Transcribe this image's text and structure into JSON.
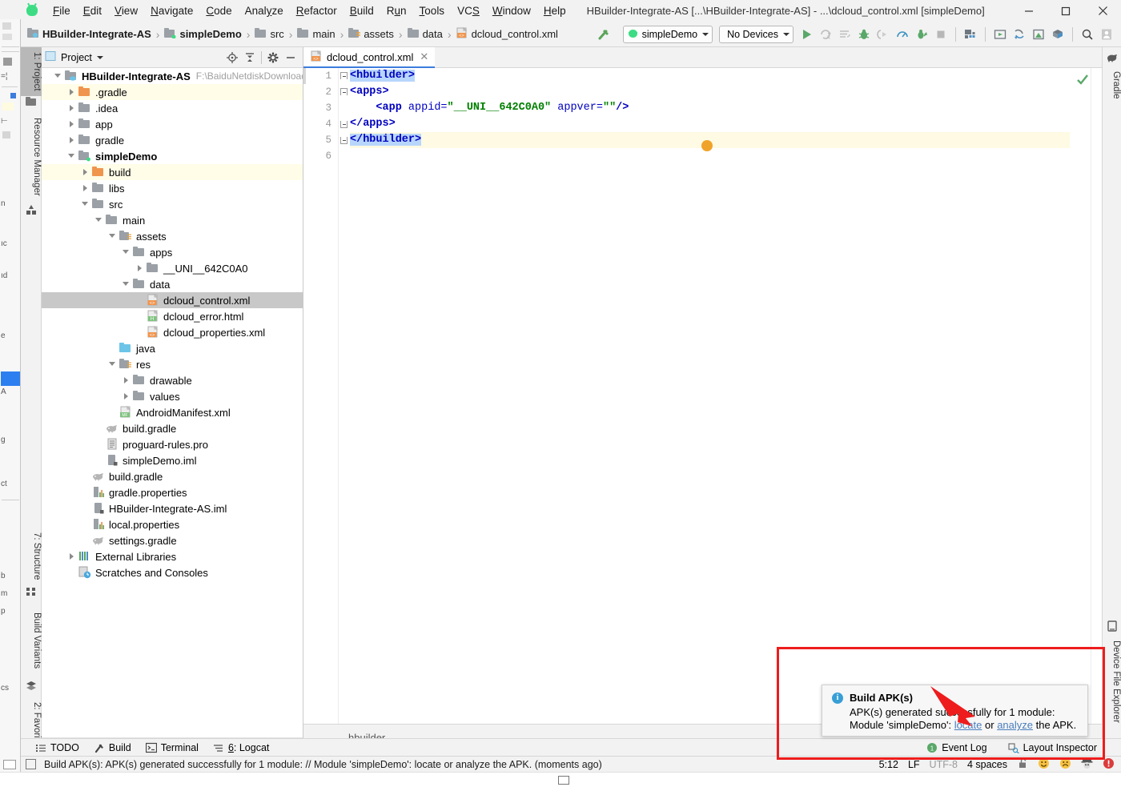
{
  "window": {
    "title": "HBuilder-Integrate-AS [...\\HBuilder-Integrate-AS] - ...\\dcloud_control.xml [simpleDemo]",
    "minimize": "minimize-icon",
    "maximize": "maximize-icon",
    "close": "close-icon"
  },
  "menu": {
    "items": [
      {
        "label": "File"
      },
      {
        "label": "Edit"
      },
      {
        "label": "View"
      },
      {
        "label": "Navigate"
      },
      {
        "label": "Code"
      },
      {
        "label": "Analyze"
      },
      {
        "label": "Refactor"
      },
      {
        "label": "Build"
      },
      {
        "label": "Run"
      },
      {
        "label": "Tools"
      },
      {
        "label": "VCS"
      },
      {
        "label": "Window"
      },
      {
        "label": "Help"
      }
    ]
  },
  "navbar": {
    "breadcrumbs": [
      {
        "label": "HBuilder-Integrate-AS",
        "icon": "module-icon",
        "bold": true
      },
      {
        "label": "simpleDemo",
        "icon": "module-icon",
        "bold": true
      },
      {
        "label": "src",
        "icon": "folder-icon",
        "bold": false
      },
      {
        "label": "main",
        "icon": "folder-icon",
        "bold": false
      },
      {
        "label": "assets",
        "icon": "source-folder-icon",
        "bold": false
      },
      {
        "label": "data",
        "icon": "folder-icon",
        "bold": false
      },
      {
        "label": "dcloud_control.xml",
        "icon": "xml-file-icon",
        "bold": false
      }
    ],
    "separator": "›",
    "run_config": "simpleDemo",
    "device_selector": "No Devices",
    "icons": [
      "hammer-build-icon",
      "run-icon",
      "apply-changes-icon",
      "apply-code-changes-icon",
      "debug-icon",
      "attach-debugger-icon",
      "profiler-icon",
      "run-with-coverage-icon",
      "stop-icon",
      "sdk-manager-icon",
      "avd-manager-icon",
      "sync-gradle-icon",
      "device-manager-icon",
      "project-structure-icon",
      "search-icon",
      "user-icon"
    ]
  },
  "left_strip": {
    "tabs": [
      {
        "label": "1: Project",
        "active": true,
        "icon": "project-icon"
      },
      {
        "label": "Resource Manager",
        "active": false,
        "icon": "resource-manager-icon"
      },
      {
        "label": "7: Structure",
        "active": false,
        "icon": "structure-icon"
      },
      {
        "label": "Build Variants",
        "active": false,
        "icon": "build-variants-icon"
      },
      {
        "label": "2: Favorites",
        "active": false,
        "icon": "star-icon"
      }
    ]
  },
  "right_strip": {
    "tabs": [
      {
        "label": "Gradle",
        "icon": "gradle-elephant-icon"
      },
      {
        "label": "Device File Explorer",
        "icon": "device-file-explorer-icon"
      }
    ]
  },
  "project_panel": {
    "title": "Project",
    "title_caret": "chevron-down-icon",
    "actions": [
      "locate-icon",
      "collapse-all-icon",
      "settings-gear-icon",
      "hide-icon"
    ],
    "tree": [
      {
        "depth": 0,
        "label": "HBuilder-Integrate-AS",
        "path": "F:\\BaiduNetdiskDownload\\la",
        "arrow": "open",
        "icon": "project-root-icon",
        "bold": true,
        "hl": false,
        "sel": false
      },
      {
        "depth": 1,
        "label": ".gradle",
        "arrow": "closed",
        "icon": "folder-orange-icon",
        "bold": false,
        "hl": true,
        "sel": false
      },
      {
        "depth": 1,
        "label": ".idea",
        "arrow": "closed",
        "icon": "folder-icon",
        "bold": false,
        "hl": false,
        "sel": false
      },
      {
        "depth": 1,
        "label": "app",
        "arrow": "closed",
        "icon": "folder-icon",
        "bold": false,
        "hl": false,
        "sel": false
      },
      {
        "depth": 1,
        "label": "gradle",
        "arrow": "closed",
        "icon": "folder-icon",
        "bold": false,
        "hl": false,
        "sel": false
      },
      {
        "depth": 1,
        "label": "simpleDemo",
        "arrow": "open",
        "icon": "module-icon",
        "bold": true,
        "hl": false,
        "sel": false
      },
      {
        "depth": 2,
        "label": "build",
        "arrow": "closed",
        "icon": "folder-orange-icon",
        "bold": false,
        "hl": true,
        "sel": false
      },
      {
        "depth": 2,
        "label": "libs",
        "arrow": "closed",
        "icon": "folder-icon",
        "bold": false,
        "hl": false,
        "sel": false
      },
      {
        "depth": 2,
        "label": "src",
        "arrow": "open",
        "icon": "folder-icon",
        "bold": false,
        "hl": false,
        "sel": false
      },
      {
        "depth": 3,
        "label": "main",
        "arrow": "open",
        "icon": "folder-icon",
        "bold": false,
        "hl": false,
        "sel": false
      },
      {
        "depth": 4,
        "label": "assets",
        "arrow": "open",
        "icon": "source-folder-icon",
        "bold": false,
        "hl": false,
        "sel": false
      },
      {
        "depth": 5,
        "label": "apps",
        "arrow": "open",
        "icon": "folder-icon",
        "bold": false,
        "hl": false,
        "sel": false
      },
      {
        "depth": 6,
        "label": "__UNI__642C0A0",
        "arrow": "closed",
        "icon": "folder-icon",
        "bold": false,
        "hl": false,
        "sel": false
      },
      {
        "depth": 5,
        "label": "data",
        "arrow": "open",
        "icon": "folder-icon",
        "bold": false,
        "hl": false,
        "sel": false
      },
      {
        "depth": 6,
        "label": "dcloud_control.xml",
        "arrow": "none",
        "icon": "xml-file-icon",
        "bold": false,
        "hl": false,
        "sel": true
      },
      {
        "depth": 6,
        "label": "dcloud_error.html",
        "arrow": "none",
        "icon": "html-file-icon",
        "bold": false,
        "hl": false,
        "sel": false
      },
      {
        "depth": 6,
        "label": "dcloud_properties.xml",
        "arrow": "none",
        "icon": "xml-file-icon",
        "bold": false,
        "hl": false,
        "sel": false
      },
      {
        "depth": 4,
        "label": "java",
        "arrow": "none",
        "icon": "folder-blue-icon",
        "bold": false,
        "hl": false,
        "sel": false
      },
      {
        "depth": 4,
        "label": "res",
        "arrow": "open",
        "icon": "source-folder-icon",
        "bold": false,
        "hl": false,
        "sel": false
      },
      {
        "depth": 5,
        "label": "drawable",
        "arrow": "closed",
        "icon": "folder-icon",
        "bold": false,
        "hl": false,
        "sel": false
      },
      {
        "depth": 5,
        "label": "values",
        "arrow": "closed",
        "icon": "folder-icon",
        "bold": false,
        "hl": false,
        "sel": false
      },
      {
        "depth": 4,
        "label": "AndroidManifest.xml",
        "arrow": "none",
        "icon": "manifest-file-icon",
        "bold": false,
        "hl": false,
        "sel": false
      },
      {
        "depth": 3,
        "label": "build.gradle",
        "arrow": "none",
        "icon": "gradle-file-icon",
        "bold": false,
        "hl": false,
        "sel": false
      },
      {
        "depth": 3,
        "label": "proguard-rules.pro",
        "arrow": "none",
        "icon": "text-file-icon",
        "bold": false,
        "hl": false,
        "sel": false
      },
      {
        "depth": 3,
        "label": "simpleDemo.iml",
        "arrow": "none",
        "icon": "iml-file-icon",
        "bold": false,
        "hl": false,
        "sel": false
      },
      {
        "depth": 2,
        "label": "build.gradle",
        "arrow": "none",
        "icon": "gradle-file-icon",
        "bold": false,
        "hl": false,
        "sel": false
      },
      {
        "depth": 2,
        "label": "gradle.properties",
        "arrow": "none",
        "icon": "properties-file-icon",
        "bold": false,
        "hl": false,
        "sel": false
      },
      {
        "depth": 2,
        "label": "HBuilder-Integrate-AS.iml",
        "arrow": "none",
        "icon": "iml-file-icon",
        "bold": false,
        "hl": false,
        "sel": false
      },
      {
        "depth": 2,
        "label": "local.properties",
        "arrow": "none",
        "icon": "properties-file-icon",
        "bold": false,
        "hl": false,
        "sel": false
      },
      {
        "depth": 2,
        "label": "settings.gradle",
        "arrow": "none",
        "icon": "gradle-file-icon",
        "bold": false,
        "hl": false,
        "sel": false
      },
      {
        "depth": 1,
        "label": "External Libraries",
        "arrow": "closed",
        "icon": "libraries-icon",
        "bold": false,
        "hl": false,
        "sel": false
      },
      {
        "depth": 1,
        "label": "Scratches and Consoles",
        "arrow": "none",
        "icon": "scratches-icon",
        "bold": false,
        "hl": false,
        "sel": false
      }
    ]
  },
  "editor": {
    "tab": {
      "label": "dcloud_control.xml",
      "icon": "xml-file-icon",
      "close": "close-tab-icon"
    },
    "line_numbers": [
      "1",
      "2",
      "3",
      "4",
      "5",
      "6"
    ],
    "lines": [
      {
        "n": 1,
        "tokens": [
          {
            "t": "<hbuilder>",
            "c": "tag",
            "sel": true
          }
        ],
        "indent": 0,
        "current": false
      },
      {
        "n": 2,
        "tokens": [
          {
            "t": "<apps>",
            "c": "tag",
            "sel": false
          }
        ],
        "indent": 0,
        "current": false
      },
      {
        "n": 3,
        "tokens": [
          {
            "t": "<app ",
            "c": "tag",
            "sel": false
          },
          {
            "t": "appid=",
            "c": "attr",
            "sel": false
          },
          {
            "t": "\"__UNI__642C0A0\"",
            "c": "val",
            "sel": false
          },
          {
            "t": " appver=",
            "c": "attr",
            "sel": false
          },
          {
            "t": "\"\"",
            "c": "val",
            "sel": false
          },
          {
            "t": "/>",
            "c": "tag",
            "sel": false
          }
        ],
        "indent": 4,
        "current": false
      },
      {
        "n": 4,
        "tokens": [
          {
            "t": "</apps>",
            "c": "tag",
            "sel": false
          }
        ],
        "indent": 0,
        "current": false
      },
      {
        "n": 5,
        "tokens": [
          {
            "t": "</hbuilder>",
            "c": "tag",
            "sel": true
          }
        ],
        "indent": 0,
        "current": true
      },
      {
        "n": 6,
        "tokens": [],
        "indent": 0,
        "current": false
      }
    ],
    "breadcrumb": "hbuilder",
    "inspection_status": "ok-check-icon"
  },
  "bottom_tabs": {
    "left": [
      {
        "label": "TODO",
        "icon": "todo-icon"
      },
      {
        "label": "Build",
        "icon": "hammer-icon"
      },
      {
        "label": "Terminal",
        "icon": "terminal-icon"
      },
      {
        "label": "6: Logcat",
        "icon": "logcat-icon"
      }
    ],
    "right": [
      {
        "label": "Event Log",
        "icon": "event-log-icon"
      },
      {
        "label": "Layout Inspector",
        "icon": "layout-inspector-icon"
      }
    ]
  },
  "status_bar": {
    "message": "Build APK(s): APK(s) generated successfully for 1 module: // Module 'simpleDemo': locate or analyze the APK. (moments ago)",
    "message_icon": "status-square-icon",
    "caret_position": "5:12",
    "line_separator": "LF",
    "encoding": "UTF-8",
    "indent": "4 spaces",
    "lock_icon": "unlocked-icon",
    "emojis": [
      "happy-face-icon",
      "sad-face-icon",
      "hacker-face-icon",
      "error-badge-icon"
    ]
  },
  "notification": {
    "icon": "info-icon",
    "title": "Build APK(s)",
    "line1": "APK(s) generated successfully for 1 module:",
    "line2_prefix": "Module 'simpleDemo': ",
    "link_locate": "locate",
    "line2_mid": " or ",
    "link_analyze": "analyze",
    "line2_suffix": " the APK.",
    "annotation_color": "#ee1c1c"
  }
}
